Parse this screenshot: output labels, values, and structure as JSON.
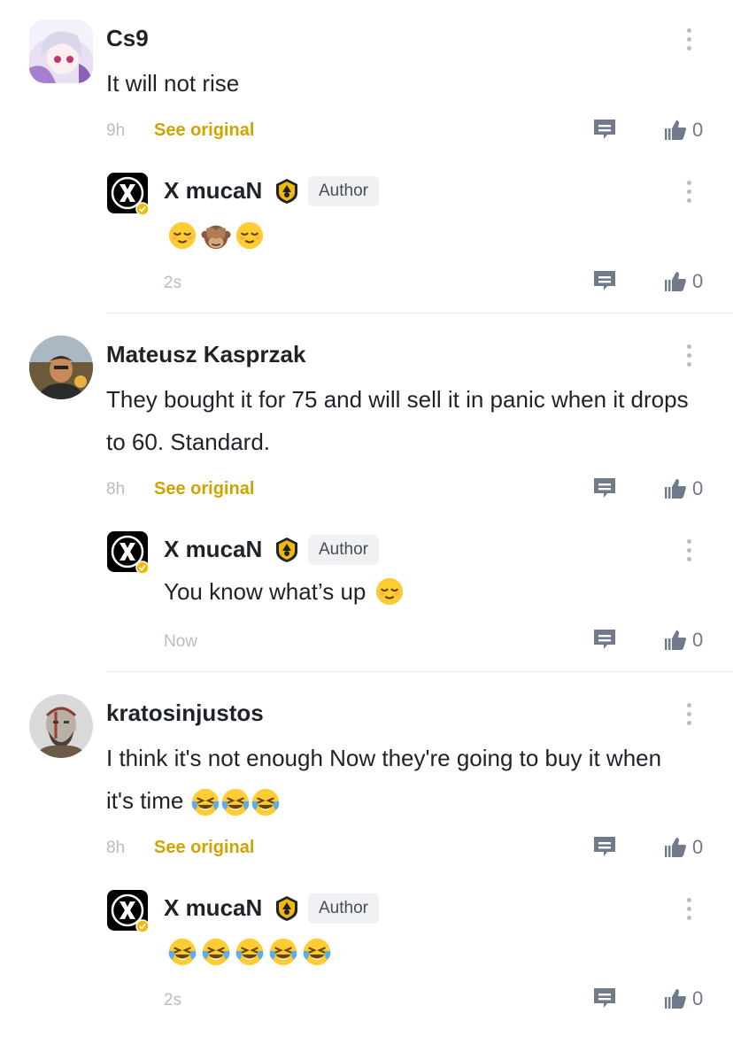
{
  "colors": {
    "accent_gold": "#d0a400",
    "muted": "#b7bdc6",
    "icon_gray": "#707a8a",
    "text": "#1e2329"
  },
  "comments": [
    {
      "username": "Cs9",
      "text": "It will not rise",
      "time": "9h",
      "see_original": "See original",
      "likes": "0",
      "avatar_icon": "anime-avatar",
      "reply": {
        "username": "X mucaN",
        "badge": "Author",
        "text": "",
        "emojis": [
          "relieved-face",
          "see-no-evil-monkey",
          "relieved-face"
        ],
        "time": "2s",
        "likes": "0"
      }
    },
    {
      "username": "Mateusz Kasprzak",
      "text": "They bought it for 75 and will sell it in panic when it drops to 60. Standard.",
      "time": "8h",
      "see_original": "See original",
      "likes": "0",
      "avatar_icon": "photo-avatar",
      "reply": {
        "username": "X mucaN",
        "badge": "Author",
        "text": "You know what’s up",
        "emojis": [
          "relieved-face"
        ],
        "time": "Now",
        "likes": "0"
      }
    },
    {
      "username": "kratosinjustos",
      "text": "I think it's not enough Now they're going to buy it when it's time",
      "time": "8h",
      "see_original": "See original",
      "likes": "0",
      "avatar_icon": "kratos-avatar",
      "reply": {
        "username": "X mucaN",
        "badge": "Author",
        "text": "",
        "emojis": [
          "tears-of-joy",
          "tears-of-joy",
          "tears-of-joy",
          "tears-of-joy",
          "tears-of-joy"
        ],
        "time": "2s",
        "likes": "0"
      }
    }
  ]
}
